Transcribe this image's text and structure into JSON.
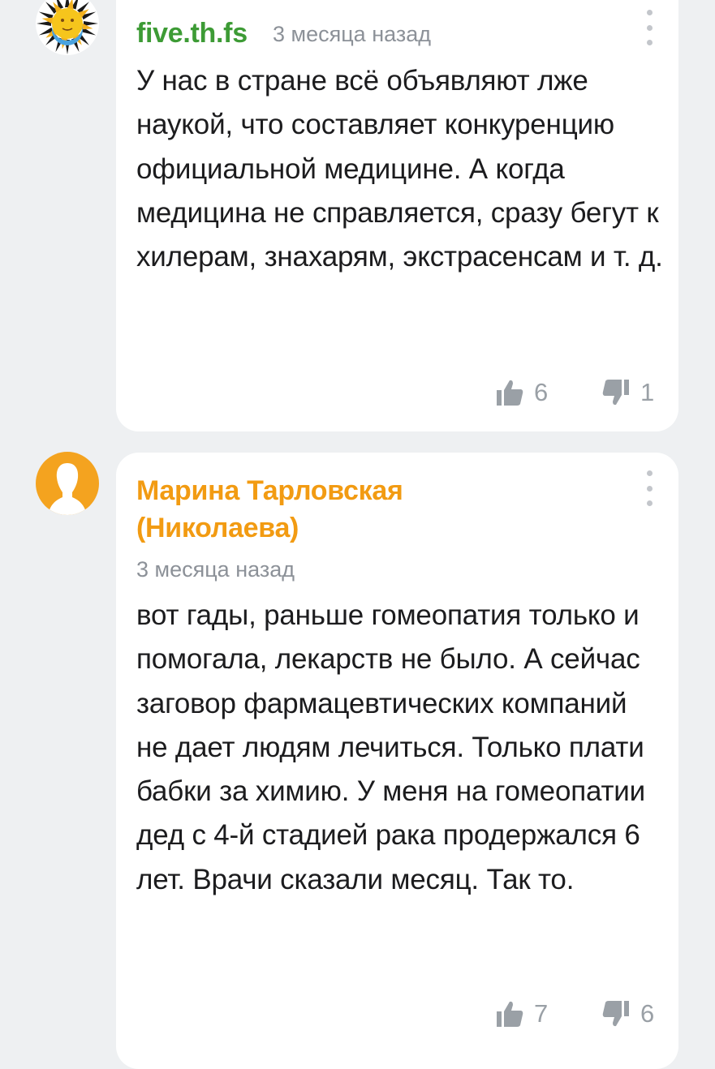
{
  "comments": [
    {
      "author": "five.th.fs",
      "time": "3 месяца назад",
      "text": "У нас в стране всё объявляют лже наукой, что составляет конкуренцию официальной медицине. А когда медицина не справляется, сразу бегут к хилерам, знахарям, экстрасенсам и т. д.",
      "likes": "6",
      "dislikes": "1",
      "author_color": "#3d9b35",
      "avatar_icon": "sun-icon"
    },
    {
      "author": "Марина Тарловская (Николаева)",
      "time": "3 месяца назад",
      "text": "вот гады, раньше гомеопатия только и помогала, лекарств не было. А сейчас заговор фармацевтических компаний не дает людям лечиться. Только плати бабки за химию. У меня на гомеопатии дед с 4-й стадией рака продержался 6 лет. Врачи сказали месяц. Так то.",
      "likes": "7",
      "dislikes": "6",
      "author_color": "#f29b12",
      "avatar_icon": "user-silhouette-icon"
    }
  ],
  "icons": {
    "like": "thumbs-up-icon",
    "dislike": "thumbs-down-icon",
    "menu": "more-vertical-icon"
  }
}
